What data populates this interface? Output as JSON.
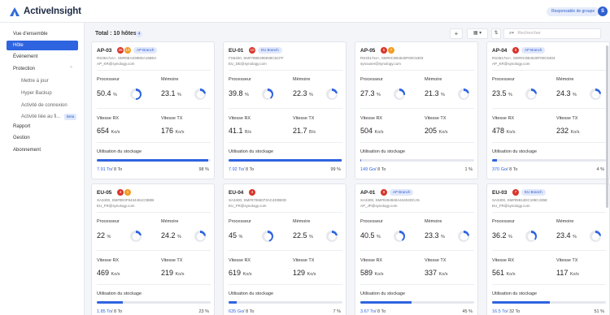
{
  "app": {
    "name": "ActiveInsight",
    "role_button": "Responsable de groupe",
    "avatar": "S"
  },
  "sidebar": {
    "items": [
      {
        "label": "Vue d'ensemble"
      },
      {
        "label": "Hôte",
        "active": true
      },
      {
        "label": "Événement"
      },
      {
        "label": "Protection"
      },
      {
        "label": "Mettre à jour"
      },
      {
        "label": "Hyper Backup"
      },
      {
        "label": "Activité de connexion"
      },
      {
        "label": "Activité liée au fi...",
        "badge": "Beta"
      },
      {
        "label": "Rapport"
      },
      {
        "label": "Gestion"
      },
      {
        "label": "Abonnement"
      }
    ]
  },
  "main": {
    "title": "Total : 10 hôtes",
    "info_count": "4",
    "search_placeholder": "Rechercher"
  },
  "labels": {
    "cpu": "Processeur",
    "mem": "Mémoire",
    "rx": "Vitesse RX",
    "tx": "Vitesse TX",
    "storage": "Utilisation du stockage"
  },
  "hosts": [
    {
      "name": "AP-03",
      "red": "26",
      "orange": "13",
      "tag": "AP Branch",
      "model": "RS3617xs+, SM#0EA0398DA16B0A",
      "user": "AP_KR@synology.com",
      "cpu": "50.4",
      "cpu_pct": 50.4,
      "mem": "23.1",
      "mem_pct": 23.1,
      "rx": "654",
      "rx_unit": "Ko/s",
      "tx": "176",
      "tx_unit": "Ko/s",
      "used": "7.91 To",
      "total": "8 To",
      "pct": "98 %",
      "pct_val": 98
    },
    {
      "name": "EU-01",
      "red": "10",
      "tag": "EU Branch",
      "model": "FS6400, SM#788D495938C5CFF",
      "user": "EU_DE@synology.com",
      "cpu": "39.8",
      "cpu_pct": 39.8,
      "mem": "22.3",
      "mem_pct": 22.3,
      "rx": "41.1",
      "rx_unit": "B/s",
      "tx": "21.7",
      "tx_unit": "B/s",
      "used": "7.92 To",
      "total": "8 To",
      "pct": "99 %",
      "pct_val": 99
    },
    {
      "name": "AP-05",
      "red": "5",
      "orange": "7",
      "model": "RS4017xs+, SM#0C0B4540F00C5303",
      "user": "synouser@synology.com",
      "cpu": "27.3",
      "cpu_pct": 27.3,
      "mem": "21.3",
      "mem_pct": 21.3,
      "rx": "504",
      "rx_unit": "Ko/s",
      "tx": "205",
      "tx_unit": "Ko/s",
      "used": "149 Go",
      "total": "8 To",
      "pct": "1 %",
      "pct_val": 1
    },
    {
      "name": "AP-04",
      "red": "6",
      "tag": "AP Branch",
      "model": "RS3617xs+, SM#0C0B4540F00C5303",
      "user": "AP_KR@synology.com",
      "cpu": "23.5",
      "cpu_pct": 23.5,
      "mem": "24.3",
      "mem_pct": 24.3,
      "rx": "478",
      "rx_unit": "Ko/s",
      "tx": "232",
      "tx_unit": "Ko/s",
      "used": "370 Go",
      "total": "8 To",
      "pct": "4 %",
      "pct_val": 4
    },
    {
      "name": "EU-05",
      "red": "4",
      "orange": "1",
      "model": "SA3400, SM#0E0F9434451C0B0B",
      "user": "EU_FR@synology.com",
      "cpu": "22",
      "cpu_pct": 22,
      "mem": "24.2",
      "mem_pct": 24.2,
      "rx": "469",
      "rx_unit": "Ko/s",
      "tx": "219",
      "tx_unit": "Ko/s",
      "used": "1.85 To",
      "total": "8 To",
      "pct": "23 %",
      "pct_val": 23
    },
    {
      "name": "EU-04",
      "red": "4",
      "model": "SA3400, SM#07065073AC4D0B0D",
      "user": "EU_FR@synology.com",
      "cpu": "45",
      "cpu_pct": 45,
      "mem": "22.5",
      "mem_pct": 22.5,
      "rx": "619",
      "rx_unit": "Ko/s",
      "tx": "129",
      "tx_unit": "Ko/s",
      "used": "635 Go",
      "total": "8 To",
      "pct": "7 %",
      "pct_val": 7
    },
    {
      "name": "AP-01",
      "red": "8",
      "tag": "AP Branch",
      "model": "SA3400, SM#0494840A44404DCA5",
      "user": "AP_JP@synology.com",
      "cpu": "40.5",
      "cpu_pct": 40.5,
      "mem": "23.3",
      "mem_pct": 23.3,
      "rx": "589",
      "rx_unit": "Ko/s",
      "tx": "337",
      "tx_unit": "Ko/s",
      "used": "3.67 To",
      "total": "8 To",
      "pct": "45 %",
      "pct_val": 45
    },
    {
      "name": "EU-03",
      "red": "7",
      "tag": "EU Branch",
      "model": "SA3400, SM#05914DC195C435E",
      "user": "EU_FR@synology.com",
      "cpu": "36.2",
      "cpu_pct": 36.2,
      "mem": "23.4",
      "mem_pct": 23.4,
      "rx": "561",
      "rx_unit": "Ko/s",
      "tx": "117",
      "tx_unit": "Ko/s",
      "used": "16.5 To",
      "total": "32 To",
      "pct": "51 %",
      "pct_val": 51
    }
  ],
  "colors": {
    "accent": "#2f64e0",
    "critical": "#d9342b",
    "warning": "#f29b21"
  }
}
